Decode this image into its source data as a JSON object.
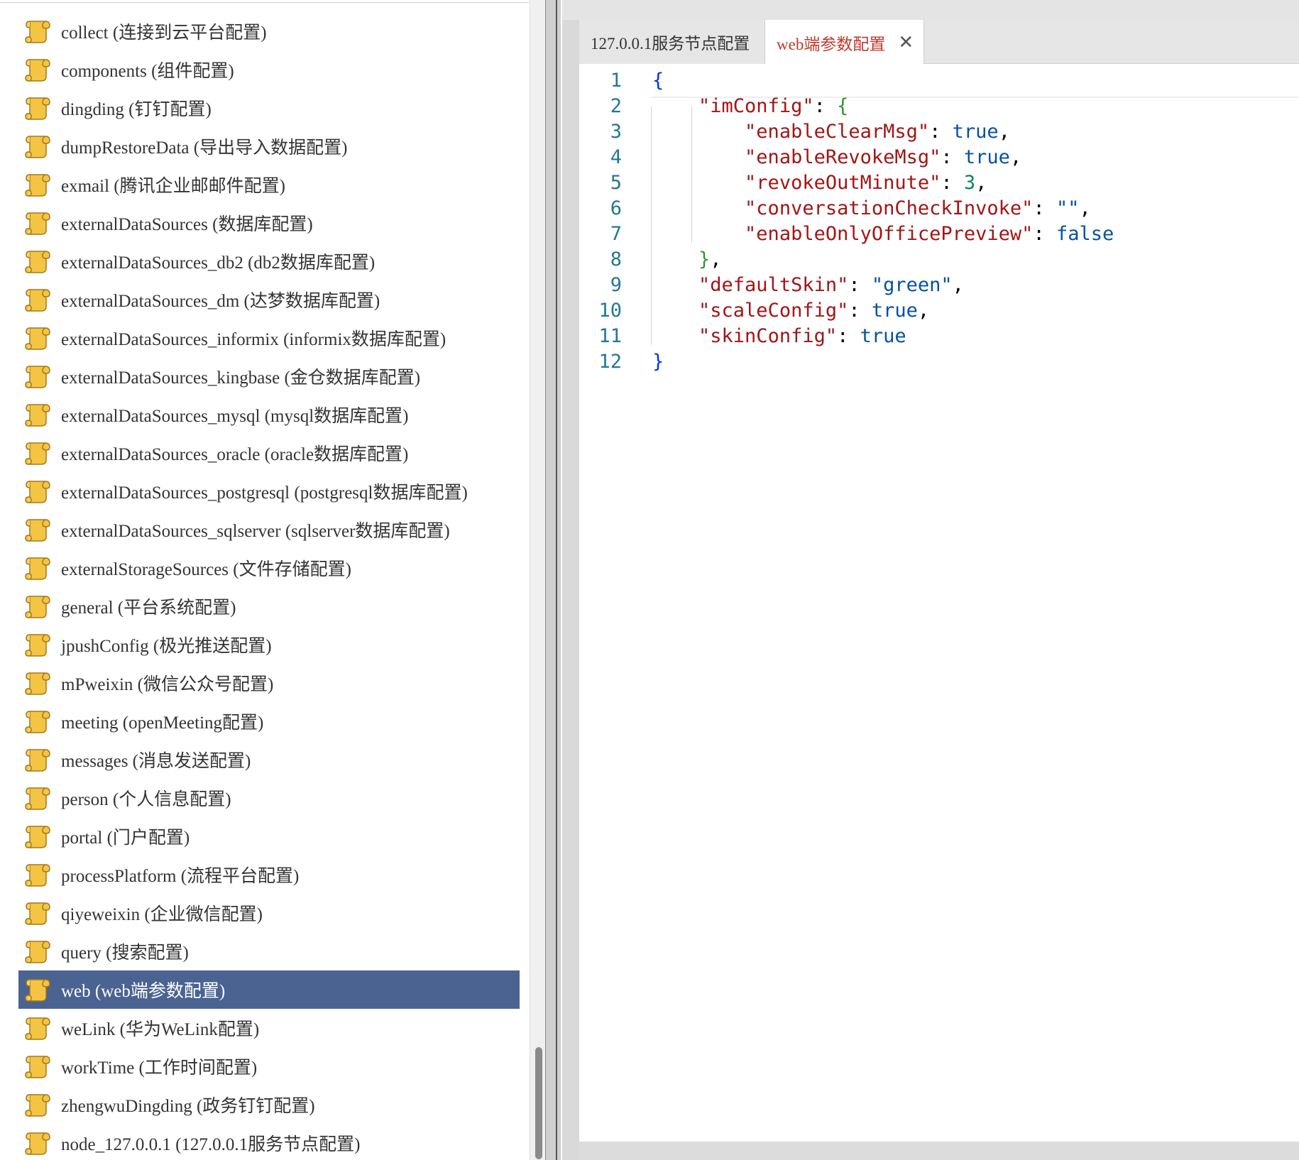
{
  "tree": {
    "items": [
      {
        "label": "collect (连接到云平台配置)",
        "selected": false
      },
      {
        "label": "components (组件配置)",
        "selected": false
      },
      {
        "label": "dingding (钉钉配置)",
        "selected": false
      },
      {
        "label": "dumpRestoreData (导出导入数据配置)",
        "selected": false
      },
      {
        "label": "exmail (腾讯企业邮邮件配置)",
        "selected": false
      },
      {
        "label": "externalDataSources (数据库配置)",
        "selected": false
      },
      {
        "label": "externalDataSources_db2 (db2数据库配置)",
        "selected": false
      },
      {
        "label": "externalDataSources_dm (达梦数据库配置)",
        "selected": false
      },
      {
        "label": "externalDataSources_informix (informix数据库配置)",
        "selected": false
      },
      {
        "label": "externalDataSources_kingbase (金仓数据库配置)",
        "selected": false
      },
      {
        "label": "externalDataSources_mysql (mysql数据库配置)",
        "selected": false
      },
      {
        "label": "externalDataSources_oracle (oracle数据库配置)",
        "selected": false
      },
      {
        "label": "externalDataSources_postgresql (postgresql数据库配置)",
        "selected": false
      },
      {
        "label": "externalDataSources_sqlserver (sqlserver数据库配置)",
        "selected": false
      },
      {
        "label": "externalStorageSources (文件存储配置)",
        "selected": false
      },
      {
        "label": "general (平台系统配置)",
        "selected": false
      },
      {
        "label": "jpushConfig (极光推送配置)",
        "selected": false
      },
      {
        "label": "mPweixin (微信公众号配置)",
        "selected": false
      },
      {
        "label": "meeting (openMeeting配置)",
        "selected": false
      },
      {
        "label": "messages (消息发送配置)",
        "selected": false
      },
      {
        "label": "person (个人信息配置)",
        "selected": false
      },
      {
        "label": "portal (门户配置)",
        "selected": false
      },
      {
        "label": "processPlatform (流程平台配置)",
        "selected": false
      },
      {
        "label": "qiyeweixin (企业微信配置)",
        "selected": false
      },
      {
        "label": "query (搜索配置)",
        "selected": false
      },
      {
        "label": "web (web端参数配置)",
        "selected": true
      },
      {
        "label": "weLink (华为WeLink配置)",
        "selected": false
      },
      {
        "label": "workTime (工作时间配置)",
        "selected": false
      },
      {
        "label": "zhengwuDingding (政务钉钉配置)",
        "selected": false
      },
      {
        "label": "node_127.0.0.1 (127.0.0.1服务节点配置)",
        "selected": false
      }
    ],
    "item_icon": "scroll-file-icon",
    "selected_color": "#4a6390"
  },
  "tabs": {
    "items": [
      {
        "label": "127.0.0.1服务节点配置",
        "active": false
      },
      {
        "label": "web端参数配置",
        "active": true,
        "close_icon": "close-icon",
        "close_glyph": "✕"
      }
    ]
  },
  "editor": {
    "lines": [
      [
        {
          "t": "{",
          "c": "brace-1"
        }
      ],
      [
        {
          "t": "    "
        },
        {
          "t": "\"imConfig\"",
          "c": "key"
        },
        {
          "t": ": ",
          "c": "punct"
        },
        {
          "t": "{",
          "c": "brace-2"
        }
      ],
      [
        {
          "t": "        "
        },
        {
          "t": "\"enableClearMsg\"",
          "c": "key"
        },
        {
          "t": ": ",
          "c": "punct"
        },
        {
          "t": "true",
          "c": "bool"
        },
        {
          "t": ",",
          "c": "punct"
        }
      ],
      [
        {
          "t": "        "
        },
        {
          "t": "\"enableRevokeMsg\"",
          "c": "key"
        },
        {
          "t": ": ",
          "c": "punct"
        },
        {
          "t": "true",
          "c": "bool"
        },
        {
          "t": ",",
          "c": "punct"
        }
      ],
      [
        {
          "t": "        "
        },
        {
          "t": "\"revokeOutMinute\"",
          "c": "key"
        },
        {
          "t": ": ",
          "c": "punct"
        },
        {
          "t": "3",
          "c": "num"
        },
        {
          "t": ",",
          "c": "punct"
        }
      ],
      [
        {
          "t": "        "
        },
        {
          "t": "\"conversationCheckInvoke\"",
          "c": "key"
        },
        {
          "t": ": ",
          "c": "punct"
        },
        {
          "t": "\"\"",
          "c": "str"
        },
        {
          "t": ",",
          "c": "punct"
        }
      ],
      [
        {
          "t": "        "
        },
        {
          "t": "\"enableOnlyOfficePreview\"",
          "c": "key"
        },
        {
          "t": ": ",
          "c": "punct"
        },
        {
          "t": "false",
          "c": "bool"
        }
      ],
      [
        {
          "t": "    "
        },
        {
          "t": "}",
          "c": "brace-2"
        },
        {
          "t": ",",
          "c": "punct"
        }
      ],
      [
        {
          "t": "    "
        },
        {
          "t": "\"defaultSkin\"",
          "c": "key"
        },
        {
          "t": ": ",
          "c": "punct"
        },
        {
          "t": "\"green\"",
          "c": "str"
        },
        {
          "t": ",",
          "c": "punct"
        }
      ],
      [
        {
          "t": "    "
        },
        {
          "t": "\"scaleConfig\"",
          "c": "key"
        },
        {
          "t": ": ",
          "c": "punct"
        },
        {
          "t": "true",
          "c": "bool"
        },
        {
          "t": ",",
          "c": "punct"
        }
      ],
      [
        {
          "t": "    "
        },
        {
          "t": "\"skinConfig\"",
          "c": "key"
        },
        {
          "t": ": ",
          "c": "punct"
        },
        {
          "t": "true",
          "c": "bool"
        }
      ],
      [
        {
          "t": "}",
          "c": "brace-1"
        }
      ]
    ],
    "line_numbers": [
      "1",
      "2",
      "3",
      "4",
      "5",
      "6",
      "7",
      "8",
      "9",
      "10",
      "11",
      "12"
    ]
  }
}
